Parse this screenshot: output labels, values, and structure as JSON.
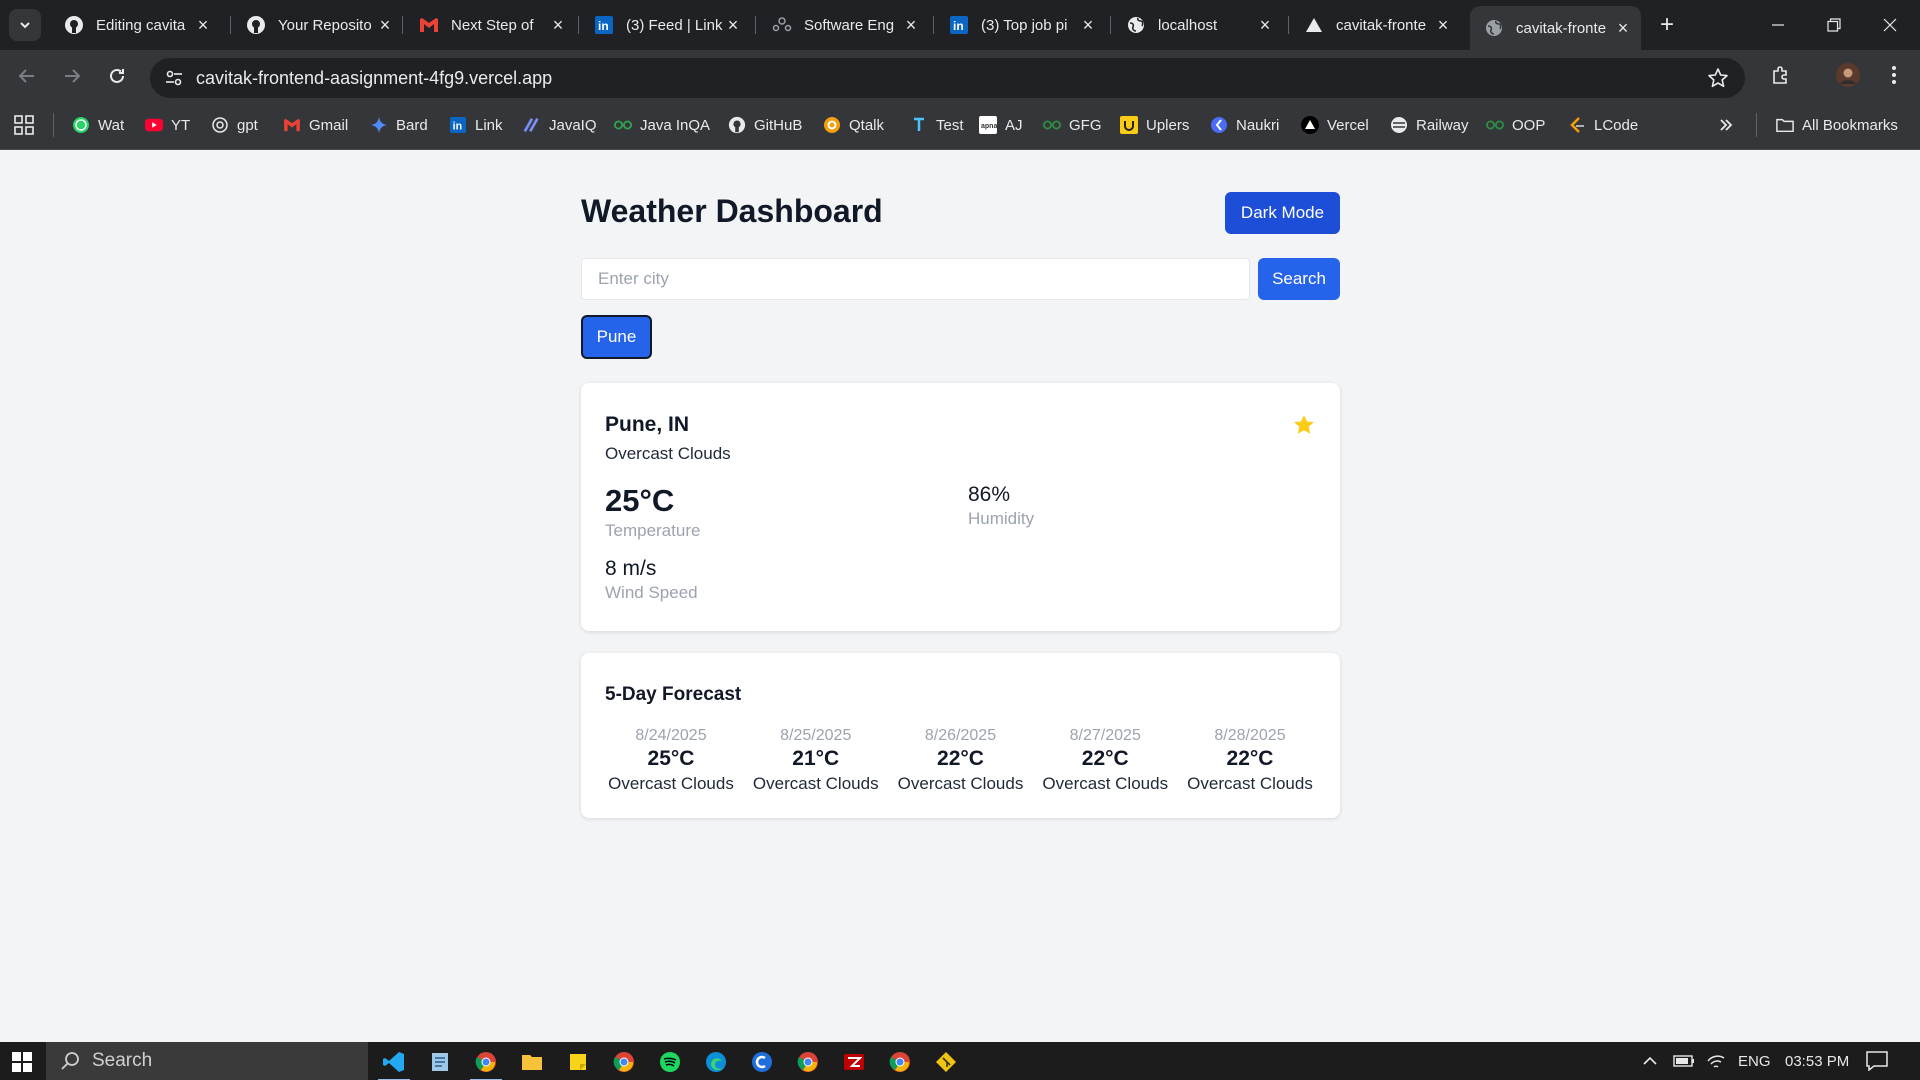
{
  "browser": {
    "tabs": [
      {
        "title": "Editing cavita",
        "icon": "github-icon",
        "active": false
      },
      {
        "title": "Your Reposito",
        "icon": "github-icon",
        "active": false
      },
      {
        "title": "Next Step of",
        "icon": "gmail-icon",
        "active": false
      },
      {
        "title": "(3) Feed | Link",
        "icon": "linkedin-icon",
        "active": false
      },
      {
        "title": "Software Eng",
        "icon": "people-icon",
        "active": false
      },
      {
        "title": "(3) Top job pi",
        "icon": "linkedin-icon",
        "active": false
      },
      {
        "title": "localhost",
        "icon": "globe-icon",
        "active": false
      },
      {
        "title": "cavitak-fronte",
        "icon": "vercel-icon",
        "active": false
      },
      {
        "title": "cavitak-fronte",
        "icon": "globe-icon",
        "active": true
      }
    ],
    "url": "cavitak-frontend-aasignment-4fg9.vercel.app",
    "bookmarks": [
      {
        "label": "Wat",
        "icon": "whatsapp-icon",
        "color": "#25d366"
      },
      {
        "label": "YT",
        "icon": "youtube-icon",
        "color": "#ff0033"
      },
      {
        "label": "gpt",
        "icon": "openai-icon",
        "color": "#e8eaed"
      },
      {
        "label": "Gmail",
        "icon": "gmail-icon",
        "color": "#ea4335"
      },
      {
        "label": "Bard",
        "icon": "bard-icon",
        "color": "#4f8bf9"
      },
      {
        "label": "Link",
        "icon": "linkedin-icon",
        "color": "#0a66c2"
      },
      {
        "label": "JavaIQ",
        "icon": "javaiq-icon",
        "color": "#7c8df5"
      },
      {
        "label": "Java InQA",
        "icon": "java-inqa-icon",
        "color": "#2ea44f"
      },
      {
        "label": "GitHuB",
        "icon": "github-icon",
        "color": "#e8eaed"
      },
      {
        "label": "Qtalk",
        "icon": "qtalk-icon",
        "color": "#f59e0b"
      },
      {
        "label": "Test",
        "icon": "test-icon",
        "color": "#4cc3ff"
      },
      {
        "label": "AJ",
        "icon": "aj-icon",
        "color": "#ffffff"
      },
      {
        "label": "GFG",
        "icon": "gfg-icon",
        "color": "#2f8d46"
      },
      {
        "label": "Uplers",
        "icon": "uplers-icon",
        "color": "#facc15"
      },
      {
        "label": "Naukri",
        "icon": "naukri-icon",
        "color": "#4a6cf7"
      },
      {
        "label": "Vercel",
        "icon": "vercel-icon",
        "color": "#ffffff"
      },
      {
        "label": "Railway",
        "icon": "railway-icon",
        "color": "#e8eaed"
      },
      {
        "label": "OOP",
        "icon": "oop-icon",
        "color": "#2f8d46"
      },
      {
        "label": "LCode",
        "icon": "leetcode-icon",
        "color": "#f59e0b"
      }
    ],
    "all_bookmarks_label": "All Bookmarks"
  },
  "app": {
    "title": "Weather Dashboard",
    "dark_mode_label": "Dark Mode",
    "search_placeholder": "Enter city",
    "search_value": "",
    "search_label": "Search",
    "favorites": [
      "Pune"
    ],
    "current": {
      "city": "Pune, IN",
      "description": "Overcast Clouds",
      "favorited": true,
      "temperature": "25°C",
      "temperature_label": "Temperature",
      "humidity": "86%",
      "humidity_label": "Humidity",
      "wind": "8 m/s",
      "wind_label": "Wind Speed"
    },
    "forecast": {
      "title": "5-Day Forecast",
      "days": [
        {
          "date": "8/24/2025",
          "temp": "25°C",
          "desc": "Overcast Clouds"
        },
        {
          "date": "8/25/2025",
          "temp": "21°C",
          "desc": "Overcast Clouds"
        },
        {
          "date": "8/26/2025",
          "temp": "22°C",
          "desc": "Overcast Clouds"
        },
        {
          "date": "8/27/2025",
          "temp": "22°C",
          "desc": "Overcast Clouds"
        },
        {
          "date": "8/28/2025",
          "temp": "22°C",
          "desc": "Overcast Clouds"
        }
      ]
    },
    "colors": {
      "primary": "#2563eb",
      "dark_button": "#1d4ed8",
      "star": "#facc15"
    }
  },
  "taskbar": {
    "search_label": "Search",
    "apps": [
      "vscode-icon",
      "notepad-icon",
      "chrome-icon",
      "file-explorer-icon",
      "sticky-notes-icon",
      "chrome-profile-icon",
      "spotify-icon",
      "edge-icon",
      "cursor-icon",
      "chrome-profile-2-icon",
      "filezilla-icon",
      "chrome-profile-3-icon",
      "git-icon"
    ],
    "language": "ENG",
    "time": "03:53 PM"
  }
}
